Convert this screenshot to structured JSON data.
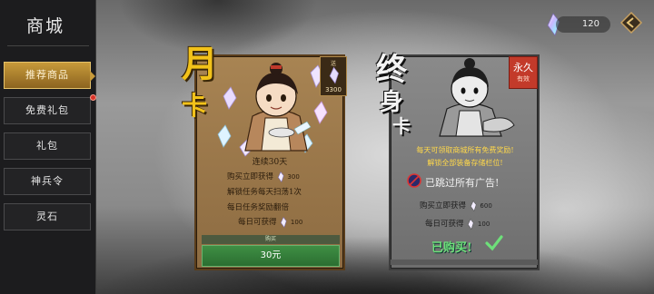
{
  "sidebar": {
    "title": "商城",
    "items": [
      {
        "label": "推荐商品",
        "active": true,
        "dot": false
      },
      {
        "label": "免费礼包",
        "active": false,
        "dot": true
      },
      {
        "label": "礼包",
        "active": false,
        "dot": false
      },
      {
        "label": "神兵令",
        "active": false,
        "dot": false
      },
      {
        "label": "灵石",
        "active": false,
        "dot": false
      }
    ]
  },
  "header": {
    "currency_amount": "120",
    "currency_icon": "crystal-icon",
    "back_icon": "back-arrow-icon"
  },
  "month_card": {
    "title_big": "月",
    "title_small": "卡",
    "price_tag_small": "送",
    "price_tag_amount": "3300",
    "subtitle": "连续30天",
    "rows": [
      {
        "label": "购买立即获得",
        "value": "300"
      },
      {
        "label": "解锁任务每天扫荡1次",
        "value": ""
      },
      {
        "label": "每日任务奖励翻倍",
        "value": ""
      },
      {
        "label": "每日可获得",
        "value": "100"
      }
    ],
    "buy_label": "购买",
    "buy_price": "30元"
  },
  "life_card": {
    "title_a": "终",
    "title_b": "身",
    "title_c": "卡",
    "tag_main": "永久",
    "tag_sub": "有效",
    "desc1": "每天可领取商城所有免费奖励!",
    "desc2": "解锁全部装备存储栏位!",
    "ad_text": "已跳过所有广告!",
    "rows": [
      {
        "label": "购买立即获得",
        "value": "600"
      },
      {
        "label": "每日可获得",
        "value": "100"
      }
    ],
    "purchased_text": "已购买!"
  },
  "colors": {
    "active_tab": "#c79a3a",
    "month_accent": "#f2c21a",
    "buy_green": "#3f8f44",
    "purchased_green": "#6ee07a",
    "desc_yellow": "#ffd84a",
    "tag_red": "#c33a2a"
  }
}
